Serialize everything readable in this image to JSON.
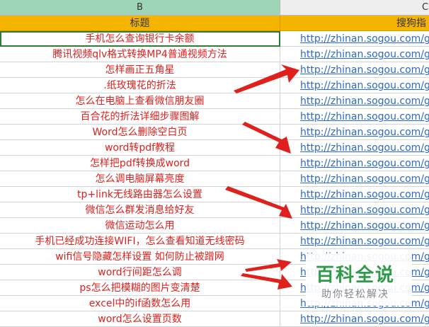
{
  "columns": {
    "b": "B",
    "c": "C"
  },
  "header": {
    "title": "标题",
    "link": "搜狗指"
  },
  "rows": [
    {
      "title": "手机怎么查询银行卡余额",
      "link": "http://zhinan.sogou.com/gu"
    },
    {
      "title": "腾讯视频qlv格式转换MP4普通视频方法",
      "link": "http://zhinan.sogou.com/gu"
    },
    {
      "title": "怎样画正五角星",
      "link": "http://zhinan.sogou.com/gu"
    },
    {
      "title": ".纸玫瑰花的折法",
      "link": "http://zhinan.sogou.com/gu"
    },
    {
      "title": "怎么在电脑上查看微信朋友圈",
      "link": "http://zhinan.sogou.com/gu"
    },
    {
      "title": "百合花的折法详细步骤图解",
      "link": "http://zhinan.sogou.com/gu"
    },
    {
      "title": "Word怎么删除空白页",
      "link": "http://zhinan.sogou.com/gu"
    },
    {
      "title": "word转pdf教程",
      "link": "http://zhinan.sogou.com/gu"
    },
    {
      "title": "怎样把pdf转换成word",
      "link": "http://zhinan.sogou.com/gu"
    },
    {
      "title": "怎么调电脑屏幕亮度",
      "link": "http://zhinan.sogou.com/gu"
    },
    {
      "title": "tp+link无线路由器怎么设置",
      "link": "http://zhinan.sogou.com/gu"
    },
    {
      "title": "微信怎么群发消息给好友",
      "link": "http://zhinan.sogou.com/gu"
    },
    {
      "title": "微信运动怎么用",
      "link": "http://zhinan.sogou.com/gu"
    },
    {
      "title": "手机已经成功连接WIFI，怎么查看知道无线密码",
      "link": "http://zhinan.sogou.com/gu"
    },
    {
      "title": "wifi信号隐藏怎样设置 如何防止被蹭网",
      "link": "http://zhinan.sogou.com/gu"
    },
    {
      "title": "word行间距怎么调",
      "link": "http://zhinan.sogou.com/gu"
    },
    {
      "title": "ps怎么把模糊的图片变清楚",
      "link": "http://zhinan.sogou.com/gu"
    },
    {
      "title": "excel中的if函数怎么用",
      "link": "http://zhinan.sogou.com/gu"
    },
    {
      "title": "word怎么设置页数",
      "link": "http://zhinan.sogou.com/gu"
    }
  ],
  "watermark": {
    "title": "百科全说",
    "subtitle": "助你轻松解决"
  },
  "colors": {
    "header_fill": "#f5b400",
    "title_text": "#e0201c",
    "link_text": "#2a6ac8",
    "arrow": "#e0201c"
  }
}
